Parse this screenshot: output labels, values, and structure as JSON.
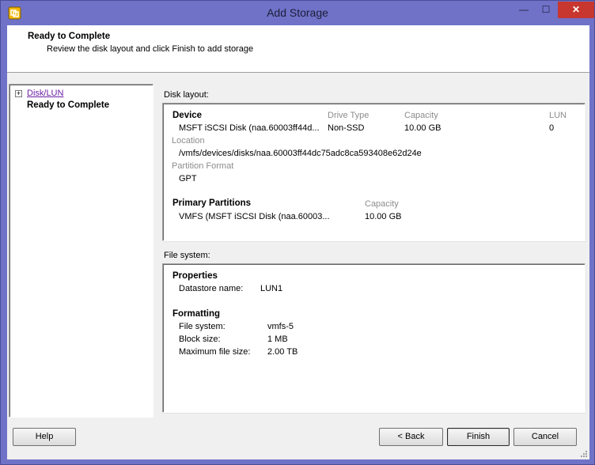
{
  "window": {
    "title": "Add Storage",
    "minimize": "—",
    "maximize": "☐",
    "close": "✕"
  },
  "header": {
    "title": "Ready to Complete",
    "subtitle": "Review the disk layout and click Finish to add storage"
  },
  "steps": {
    "expander": "+",
    "items": [
      {
        "label": "Disk/LUN"
      },
      {
        "label": "Ready to Complete"
      }
    ]
  },
  "disk_layout": {
    "label": "Disk layout:",
    "device_header": "Device",
    "drive_type_header": "Drive Type",
    "capacity_header": "Capacity",
    "lun_header": "LUN",
    "device_value": "MSFT iSCSI Disk (naa.60003ff44d...",
    "drive_type_value": "Non-SSD",
    "capacity_value": "10.00 GB",
    "lun_value": "0",
    "location_header": "Location",
    "location_value": "/vmfs/devices/disks/naa.60003ff44dc75adc8ca593408e62d24e",
    "partition_format_header": "Partition Format",
    "partition_format_value": "GPT",
    "primary_partitions_header": "Primary Partitions",
    "partition_capacity_header": "Capacity",
    "partition_value": "VMFS (MSFT iSCSI Disk (naa.60003...",
    "partition_capacity_value": "10.00 GB"
  },
  "file_system": {
    "label": "File system:",
    "properties_header": "Properties",
    "datastore_name_label": "Datastore name:",
    "datastore_name_value": "LUN1",
    "formatting_header": "Formatting",
    "fs_label": "File system:",
    "fs_value": "vmfs-5",
    "block_size_label": "Block size:",
    "block_size_value": "1 MB",
    "max_file_size_label": "Maximum file size:",
    "max_file_size_value": "2.00 TB"
  },
  "buttons": {
    "help": "Help",
    "back": "< Back",
    "finish": "Finish",
    "cancel": "Cancel"
  }
}
